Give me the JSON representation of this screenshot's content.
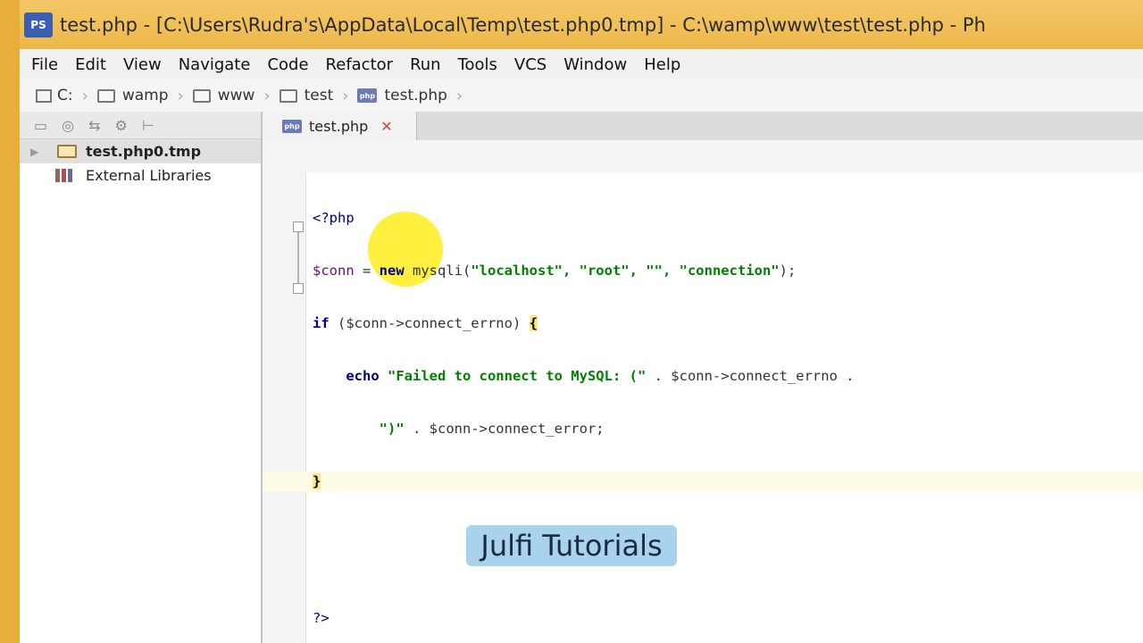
{
  "window": {
    "app_icon": "PS",
    "title": "test.php - [C:\\Users\\Rudra's\\AppData\\Local\\Temp\\test.php0.tmp] - C:\\wamp\\www\\test\\test.php - Ph"
  },
  "menu": [
    "File",
    "Edit",
    "View",
    "Navigate",
    "Code",
    "Refactor",
    "Run",
    "Tools",
    "VCS",
    "Window",
    "Help"
  ],
  "breadcrumb": [
    "C:",
    "wamp",
    "www",
    "test",
    "test.php"
  ],
  "project_tree": {
    "toolbar_icons": [
      "layout-icon",
      "locate-icon",
      "collapse-icon",
      "gear-icon",
      "pin-icon"
    ],
    "items": [
      {
        "label": "test.php0.tmp",
        "selected": true
      },
      {
        "label": "External Libraries",
        "selected": false
      }
    ]
  },
  "editor_tabs": [
    {
      "label": "test.php",
      "icon": "php-file-icon",
      "active": true
    }
  ],
  "code": {
    "open_tag": "<?php",
    "line2_var": "$conn",
    "line2_eq": " = ",
    "line2_new": "new",
    "line2_rest": " mysqli(",
    "line2_args": "\"localhost\", \"root\", \"\", \"connection\"",
    "line2_end": ");",
    "line3_if": "if",
    "line3_cond": " ($conn->connect_errno) ",
    "line3_brace": "{",
    "line4_echo": "echo",
    "line4_str": " \"Failed to connect to MySQL: (\"",
    "line4_rest": " . $conn->connect_errno .",
    "line5_str": "\")\"",
    "line5_rest": " . $conn->connect_error;",
    "line6_brace": "}",
    "close_tag": "?>"
  },
  "watermark": "Julfi Tutorials",
  "colors": {
    "title_bar": "#edb84a",
    "string": "#008000",
    "keyword": "#000080",
    "variable": "#660e7a",
    "cursor_highlight": "#ffeb00"
  }
}
